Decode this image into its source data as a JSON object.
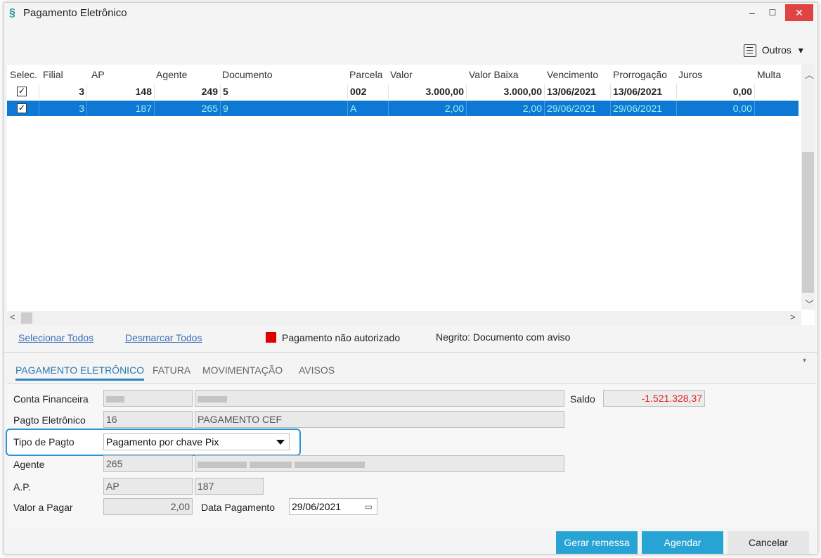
{
  "window": {
    "title": "Pagamento Eletrônico",
    "accent_color": "#27a3d4",
    "selected_row_color": "#0e78d4",
    "controls": {
      "minimize": "–",
      "maximize": "☐",
      "close": "✕"
    }
  },
  "toolbar": {
    "outros_label": "Outros"
  },
  "grid": {
    "columns": [
      "Selec.",
      "Filial",
      "AP",
      "Agente",
      "Documento",
      "Parcela",
      "Valor",
      "Valor Baixa",
      "Vencimento",
      "Prorrogação",
      "Juros",
      "Multa"
    ],
    "rows": [
      {
        "selected": true,
        "filial": "3",
        "ap": "148",
        "agente": "249",
        "documento": "5",
        "parcela": "002",
        "valor": "3.000,00",
        "valor_baixa": "3.000,00",
        "vencimento": "13/06/2021",
        "prorrogacao": "13/06/2021",
        "juros": "0,00",
        "multa": ""
      },
      {
        "selected": true,
        "filial": "3",
        "ap": "187",
        "agente": "265",
        "documento": "9",
        "parcela": "A",
        "valor": "2,00",
        "valor_baixa": "2,00",
        "vencimento": "29/06/2021",
        "prorrogacao": "29/06/2021",
        "juros": "0,00",
        "multa": ""
      }
    ]
  },
  "actions": {
    "select_all": "Selecionar Todos",
    "deselect_all": "Desmarcar Todos",
    "legend_unauthorized": "Pagamento não autorizado",
    "legend_bold": "Negrito: Documento com aviso",
    "legend_color": "#e00000"
  },
  "tabs": [
    "PAGAMENTO ELETRÔNICO",
    "FATURA",
    "MOVIMENTAÇÃO",
    "AVISOS"
  ],
  "form": {
    "conta_financeira_label": "Conta Financeira",
    "pagto_eletronico_label": "Pagto Eletrônico",
    "pagto_eletronico_code": "16",
    "pagto_eletronico_desc": "PAGAMENTO CEF",
    "saldo_label": "Saldo",
    "saldo_value": "-1.521.328,37",
    "tipo_pagto_label": "Tipo de Pagto",
    "tipo_pagto_value": "Pagamento por chave Pix",
    "agente_label": "Agente",
    "agente_code": "265",
    "ap_label": "A.P.",
    "ap_code": "AP",
    "ap_number": "187",
    "valor_pagar_label": "Valor a Pagar",
    "valor_pagar_value": "2,00",
    "data_pagamento_label": "Data Pagamento",
    "data_pagamento_value": "29/06/2021"
  },
  "buttons": {
    "gerar_remessa": "Gerar remessa",
    "agendar": "Agendar",
    "cancelar": "Cancelar"
  }
}
